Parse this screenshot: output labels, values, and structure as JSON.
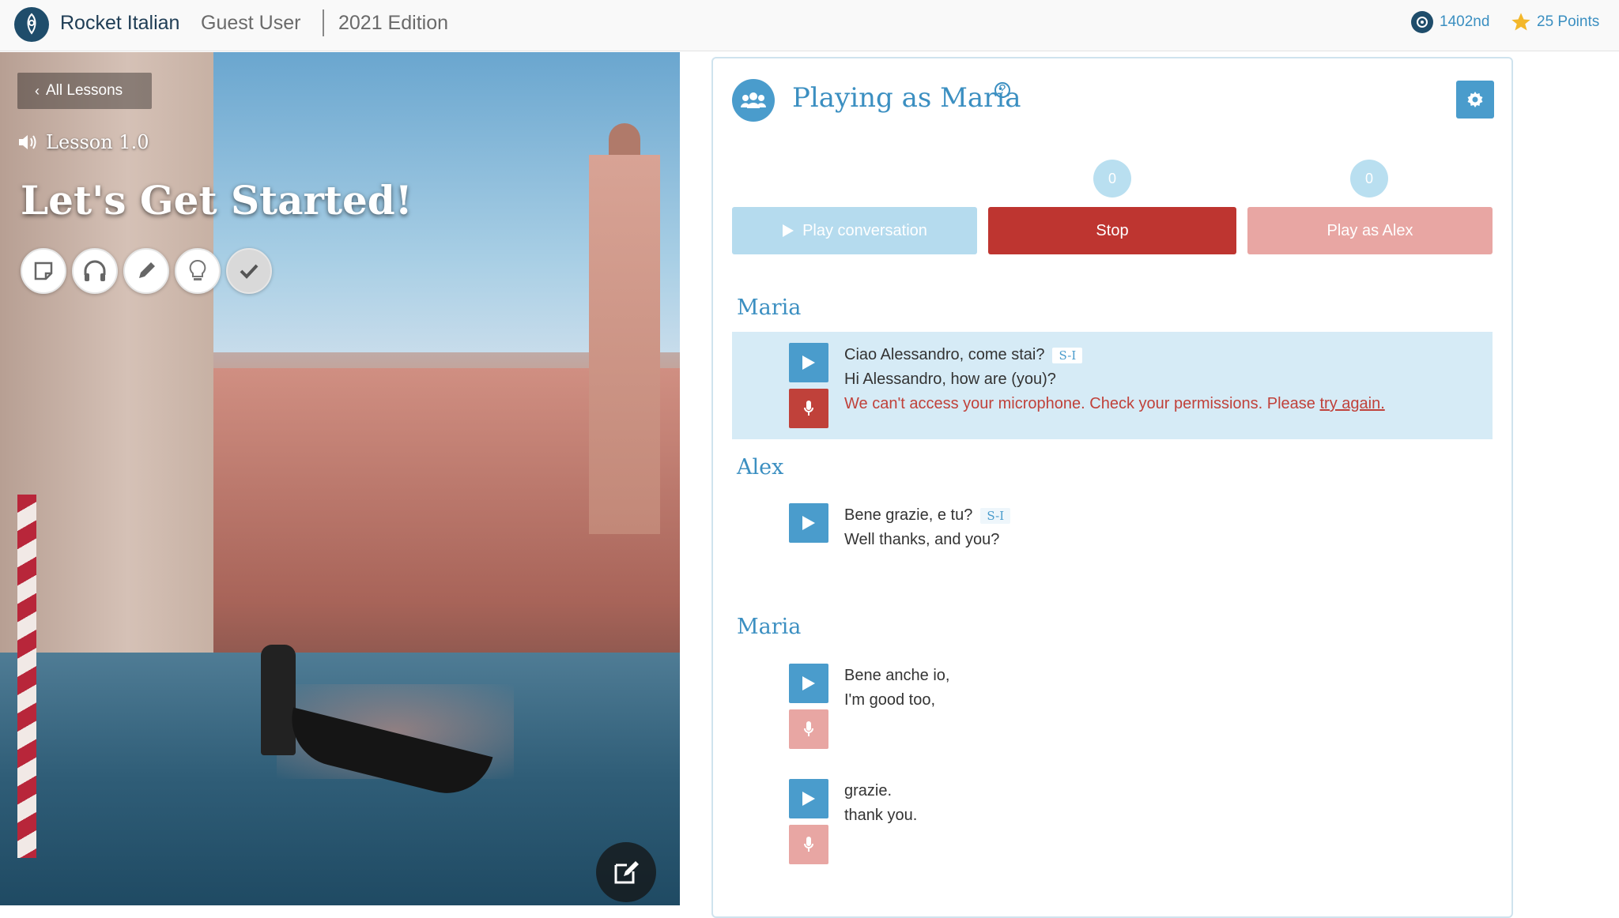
{
  "header": {
    "brand": "Rocket Italian",
    "user": "Guest User",
    "edition": "2021 Edition",
    "rank": "1402nd",
    "points": "25 Points"
  },
  "hero": {
    "back_label": "All Lessons",
    "lesson_number": "Lesson 1.0",
    "lesson_title": "Let's Get Started!",
    "tools": [
      "notes-icon",
      "headphones-icon",
      "pencil-icon",
      "lightbulb-icon",
      "checkmark-icon"
    ]
  },
  "activity": {
    "title": "Playing as Maria",
    "help": "?",
    "counters": [
      "0",
      "0"
    ],
    "buttons": {
      "play": "Play conversation",
      "stop": "Stop",
      "alex": "Play as Alex"
    },
    "dialogue": [
      {
        "speaker": "Maria",
        "lines": [
          {
            "it": "Ciao Alessandro, come stai?",
            "tag": "S-I",
            "en": "Hi Alessandro, how are (you)?",
            "error": "We can't access your microphone. Check your permissions. Please ",
            "error_link": "try again."
          }
        ]
      },
      {
        "speaker": "Alex",
        "lines": [
          {
            "it": "Bene grazie, e tu?",
            "tag": "S-I",
            "en": "Well thanks, and you?"
          }
        ]
      },
      {
        "speaker": "Maria",
        "lines": [
          {
            "it": "Bene anche io,",
            "en": "I'm good too,"
          },
          {
            "it": "grazie.",
            "en": "thank you."
          }
        ]
      }
    ]
  },
  "colors": {
    "accent_blue": "#4a9ccc",
    "stop_red": "#be3530",
    "highlight": "#d6ebf6"
  }
}
